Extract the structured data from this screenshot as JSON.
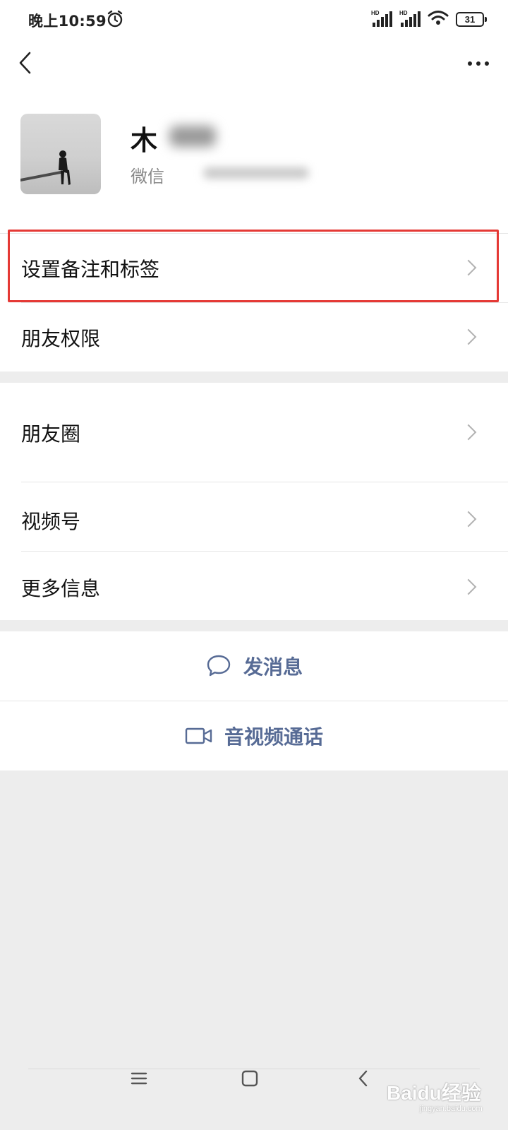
{
  "status_bar": {
    "time": "晚上10:59",
    "battery_level": "31",
    "network_label_1": "HD",
    "network_label_2": "HD"
  },
  "profile": {
    "name_visible": "木",
    "wechat_id_prefix": "微信"
  },
  "menu_group_1": [
    {
      "label": "设置备注和标签"
    },
    {
      "label": "朋友权限"
    }
  ],
  "menu_group_2": [
    {
      "label": "朋友圈"
    },
    {
      "label": "视频号"
    },
    {
      "label": "更多信息"
    }
  ],
  "actions": {
    "message": "发消息",
    "call": "音视频通话"
  },
  "watermark": {
    "brand": "Baidu经验",
    "url": "jingyan.baidu.com"
  },
  "colors": {
    "link_blue": "#576b95",
    "highlight_red": "#e53935",
    "background_gray": "#ededed"
  }
}
